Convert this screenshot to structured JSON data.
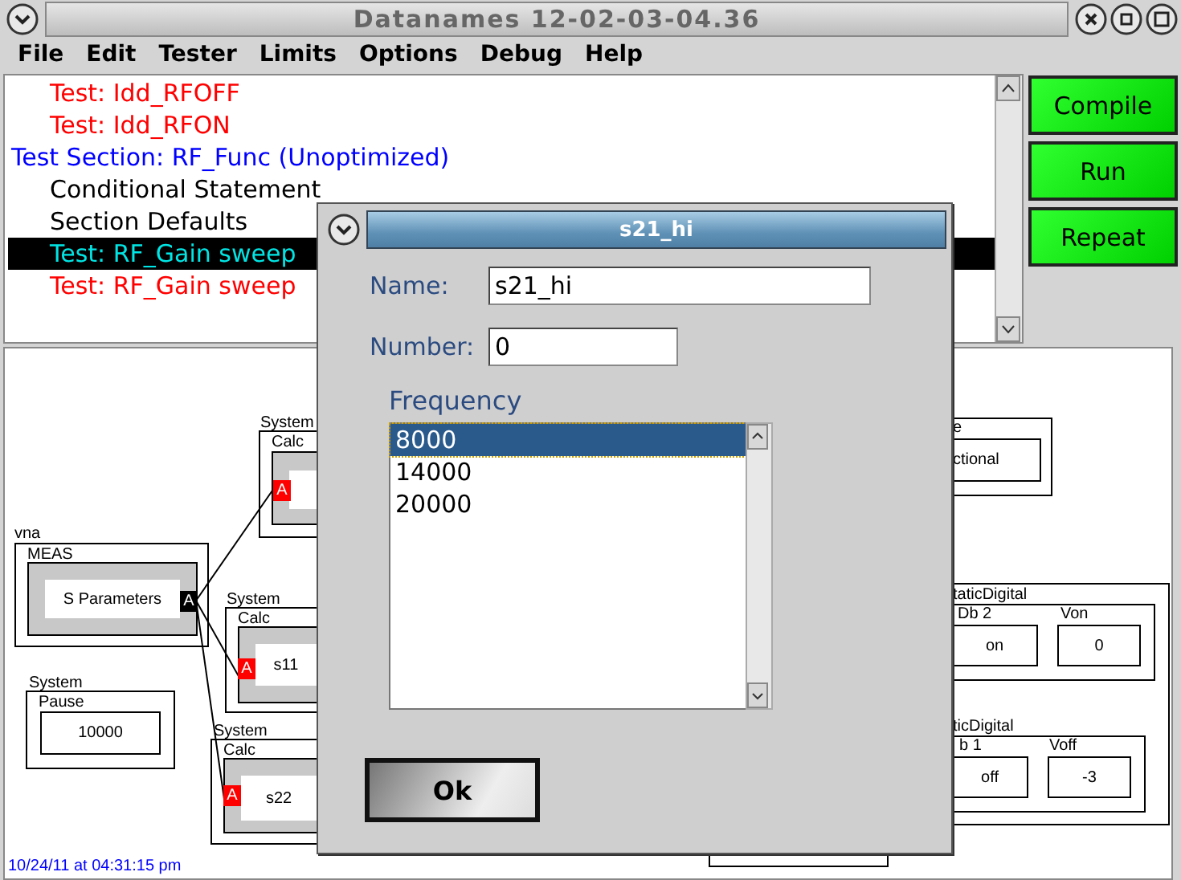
{
  "window": {
    "title": "Datanames 12-02-03-04.36"
  },
  "menu": [
    "File",
    "Edit",
    "Tester",
    "Limits",
    "Options",
    "Debug",
    "Help"
  ],
  "tree": [
    {
      "text": "Test: Idd_RFOFF",
      "kind": "test",
      "selected": false
    },
    {
      "text": "Test: Idd_RFON",
      "kind": "test",
      "selected": false
    },
    {
      "text": "Test Section: RF_Func (Unoptimized)",
      "kind": "section",
      "selected": false,
      "children": [
        {
          "text": "Conditional Statement",
          "kind": "item",
          "selected": false
        },
        {
          "text": "Section Defaults",
          "kind": "item",
          "selected": false
        },
        {
          "text": "Test: RF_Gain sweep",
          "kind": "test",
          "selected": true
        },
        {
          "text": "Test: RF_Gain sweep",
          "kind": "test",
          "selected": false
        }
      ]
    }
  ],
  "actions": [
    "Compile",
    "Run",
    "Repeat"
  ],
  "diagram": {
    "blocks": [
      {
        "kind": "calc",
        "group": "System",
        "type": "Calc",
        "port": "A",
        "color": "#ff0000"
      },
      {
        "kind": "calc",
        "group": "vna",
        "type": "MEAS",
        "value": "S Parameters",
        "port": "A",
        "color": "#000000"
      },
      {
        "kind": "calc",
        "group": "System",
        "type": "Calc",
        "value": "s11",
        "port": "A",
        "color": "#ff0000"
      },
      {
        "kind": "plain",
        "group": "System",
        "type": "Pause",
        "value": "10000"
      },
      {
        "kind": "calc",
        "group": "System",
        "type": "Calc",
        "value": "s22",
        "port": "A",
        "color": "#ff0000"
      },
      {
        "kind": "plain",
        "type": "e",
        "value": "ctional"
      },
      {
        "kind": "multi",
        "type": "taticDigital",
        "fields": [
          {
            "label": "Db 2",
            "value": "on"
          },
          {
            "label": "Von",
            "value": "0"
          }
        ]
      },
      {
        "kind": "multi",
        "type": "ticDigital",
        "fields": [
          {
            "label": "b 1",
            "value": "off"
          },
          {
            "label": "Voff",
            "value": "-3"
          }
        ]
      }
    ],
    "timestamp": "10/24/11 at 04:31:15 pm"
  },
  "dialog": {
    "title": "s21_hi",
    "name_label": "Name:",
    "name_value": "s21_hi",
    "number_label": "Number:",
    "number_value": "0",
    "list_label": "Frequency",
    "items": [
      {
        "text": "8000",
        "selected": true
      },
      {
        "text": "14000",
        "selected": false
      },
      {
        "text": "20000",
        "selected": false
      }
    ],
    "ok": "Ok"
  }
}
